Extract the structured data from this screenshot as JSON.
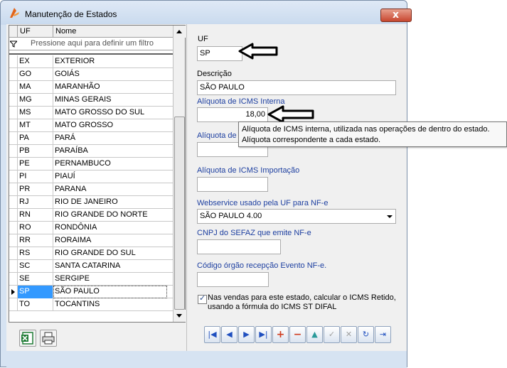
{
  "window": {
    "title": "Manutenção de Estados",
    "close_glyph": "x"
  },
  "grid": {
    "columns": [
      "UF",
      "Nome"
    ],
    "filter_placeholder": "Pressione aqui para definir um filtro",
    "rows": [
      {
        "uf": "EX",
        "nome": "EXTERIOR"
      },
      {
        "uf": "GO",
        "nome": "GOIÁS"
      },
      {
        "uf": "MA",
        "nome": "MARANHÃO"
      },
      {
        "uf": "MG",
        "nome": "MINAS GERAIS"
      },
      {
        "uf": "MS",
        "nome": "MATO GROSSO DO SUL"
      },
      {
        "uf": "MT",
        "nome": "MATO GROSSO"
      },
      {
        "uf": "PA",
        "nome": "PARÁ"
      },
      {
        "uf": "PB",
        "nome": "PARAÍBA"
      },
      {
        "uf": "PE",
        "nome": "PERNAMBUCO"
      },
      {
        "uf": "PI",
        "nome": "PIAUÍ"
      },
      {
        "uf": "PR",
        "nome": "PARANA"
      },
      {
        "uf": "RJ",
        "nome": "RIO DE JANEIRO"
      },
      {
        "uf": "RN",
        "nome": "RIO GRANDE DO NORTE"
      },
      {
        "uf": "RO",
        "nome": "RONDÔNIA"
      },
      {
        "uf": "RR",
        "nome": "RORAIMA"
      },
      {
        "uf": "RS",
        "nome": "RIO GRANDE DO SUL"
      },
      {
        "uf": "SC",
        "nome": "SANTA CATARINA"
      },
      {
        "uf": "SE",
        "nome": "SERGIPE"
      },
      {
        "uf": "SP",
        "nome": "SÃO PAULO",
        "selected": true
      },
      {
        "uf": "TO",
        "nome": "TOCANTINS"
      }
    ]
  },
  "form": {
    "uf_label": "UF",
    "uf_value": "SP",
    "descricao_label": "Descrição",
    "descricao_value": "SÃO PAULO",
    "icms_interna_label": "Alíquota de ICMS Interna",
    "icms_interna_value": "18,00",
    "icms_interestadual_label": "Alíquota de I",
    "icms_interestadual_value": "",
    "icms_importacao_label": "Alíquota de ICMS Importação",
    "icms_importacao_value": "",
    "webservice_label": "Webservice usado pela UF para NF-e",
    "webservice_value": "SÃO PAULO 4.00",
    "cnpj_label": "CNPJ do SEFAZ que emite NF-e",
    "cnpj_value": "",
    "codigo_label": "Código órgão recepção Evento NF-e.",
    "codigo_value": "",
    "checkbox_line1": "Nas vendas para este estado, calcular o ICMS Retido,",
    "checkbox_line2": "usando a fórmula do ICMS ST DIFAL",
    "checkbox_checked": true
  },
  "tooltip": {
    "line1": "Alíquota de ICMS interna, utilizada nas operações de dentro do estado.",
    "line2": "Alíquota correspondente a cada estado."
  },
  "navigator": {
    "buttons": [
      {
        "name": "first-record-button",
        "glyph": "|◀"
      },
      {
        "name": "prior-record-button",
        "glyph": "◀"
      },
      {
        "name": "next-record-button",
        "glyph": "▶"
      },
      {
        "name": "last-record-button",
        "glyph": "▶|"
      },
      {
        "name": "insert-record-button",
        "glyph": "+"
      },
      {
        "name": "delete-record-button",
        "glyph": "−"
      },
      {
        "name": "edit-record-button",
        "glyph": "▲"
      },
      {
        "name": "post-record-button",
        "glyph": "✓"
      },
      {
        "name": "cancel-record-button",
        "glyph": "✕"
      },
      {
        "name": "refresh-button",
        "glyph": "↻"
      },
      {
        "name": "exit-button",
        "glyph": "⇥"
      }
    ]
  },
  "colors": {
    "selection": "#3399ff",
    "label_blue": "#1d3fa0",
    "close_red": "#c7472f"
  }
}
